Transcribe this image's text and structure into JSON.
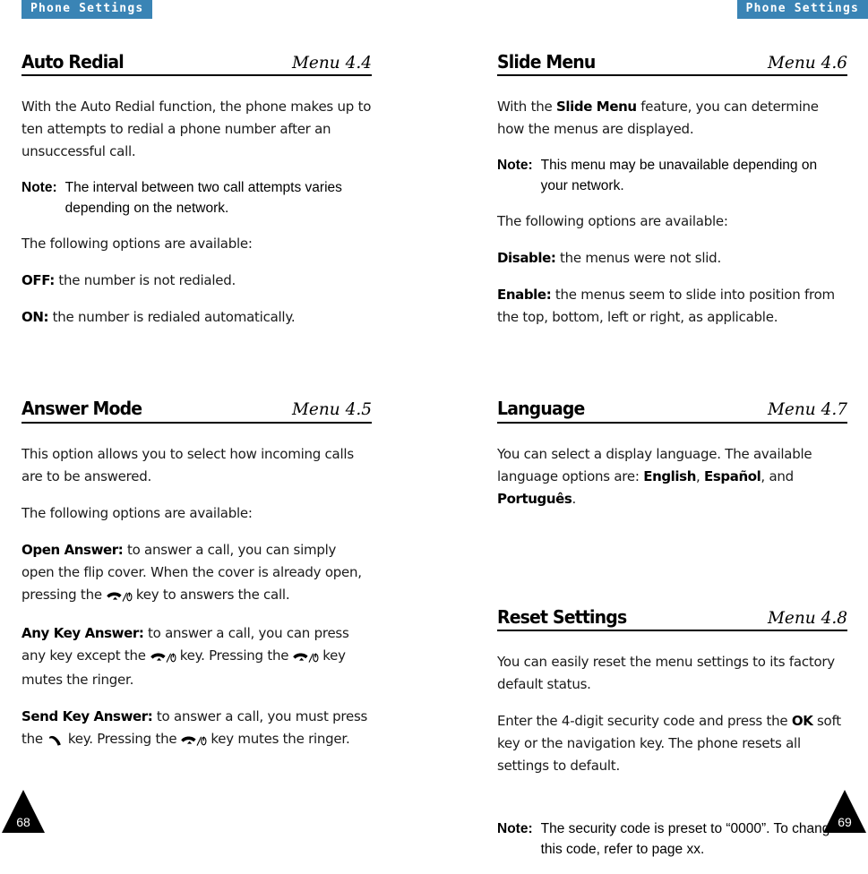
{
  "running_head": {
    "left_tab": "Phone Settings",
    "right_tab": "Phone Settings",
    "accent_color": "#3a84b5"
  },
  "page_numbers": {
    "left": "68",
    "right": "69"
  },
  "left_column": {
    "sections": [
      {
        "title": "Auto Redial",
        "menu": "Menu 4.4",
        "intro": "With the Auto Redial function, the phone makes up to ten attempts to redial a phone number after an unsuccessful call.",
        "note_label": "Note:",
        "note_body": "The interval between two call attempts varies depending on the network.",
        "options_lead": "The following options are available:",
        "option_1_label": "OFF:",
        "option_1_text": "the number is not redialed.",
        "option_2_label": "ON:",
        "option_2_text": "the number is redialed automatically."
      },
      {
        "title": "Answer Mode",
        "menu": "Menu 4.5",
        "intro": "This option allows you to select how incoming calls are to be answered.",
        "options_lead": "The following options are available:",
        "open_label": "Open Answer:",
        "open_text_a": "to answer a call, you can simply open the flip cover. When the cover is already open, pressing the",
        "open_text_b": "key to answers the call.",
        "anykey_label": "Any Key Answer:",
        "anykey_text_a": "to answer a call, you can press any key except the",
        "anykey_text_b": "key. Pressing the",
        "anykey_text_c": "key mutes the ringer.",
        "sendkey_label": "Send Key Answer:",
        "sendkey_text_a": "to answer a call, you must press the",
        "sendkey_text_b": "key. Pressing the",
        "sendkey_text_c": "key mutes the ringer."
      }
    ]
  },
  "right_column": {
    "sections": [
      {
        "title": "Slide Menu",
        "menu": "Menu 4.6",
        "intro_a": "With the",
        "intro_bold": "Slide Menu",
        "intro_b": "feature, you can determine how the menus are displayed.",
        "note_label": "Note:",
        "note_body": "This menu may be unavailable depending on your network.",
        "options_lead": "The following options are available:",
        "option_1_label": "Disable:",
        "option_1_text": "the menus were not slid.",
        "option_2_label": "Enable:",
        "option_2_text": "the menus seem to slide into position from the top, bottom, left or right, as applicable."
      },
      {
        "title": "Language",
        "menu": "Menu 4.7",
        "intro_a": "You can select a display language. The available language options are:",
        "lang_1": "English",
        "lang_sep_1": ",",
        "lang_2": "Español",
        "lang_sep_2": ", and",
        "lang_3": "Português",
        "intro_end": "."
      },
      {
        "title": "Reset Settings",
        "menu": "Menu 4.8",
        "intro": "You can easily reset the menu settings to its factory default status.",
        "detail_a": "Enter the 4-digit security code and press the",
        "detail_bold": "OK",
        "detail_b": "soft key or the navigation key. The phone resets all settings to default.",
        "note_label": "Note:",
        "note_body": "The security code is preset to “0000”. To change this code, refer to page xx."
      }
    ]
  },
  "icons": {
    "end_call_power_key": "end-call-power-key-icon",
    "send_call_key": "send-call-key-icon"
  }
}
